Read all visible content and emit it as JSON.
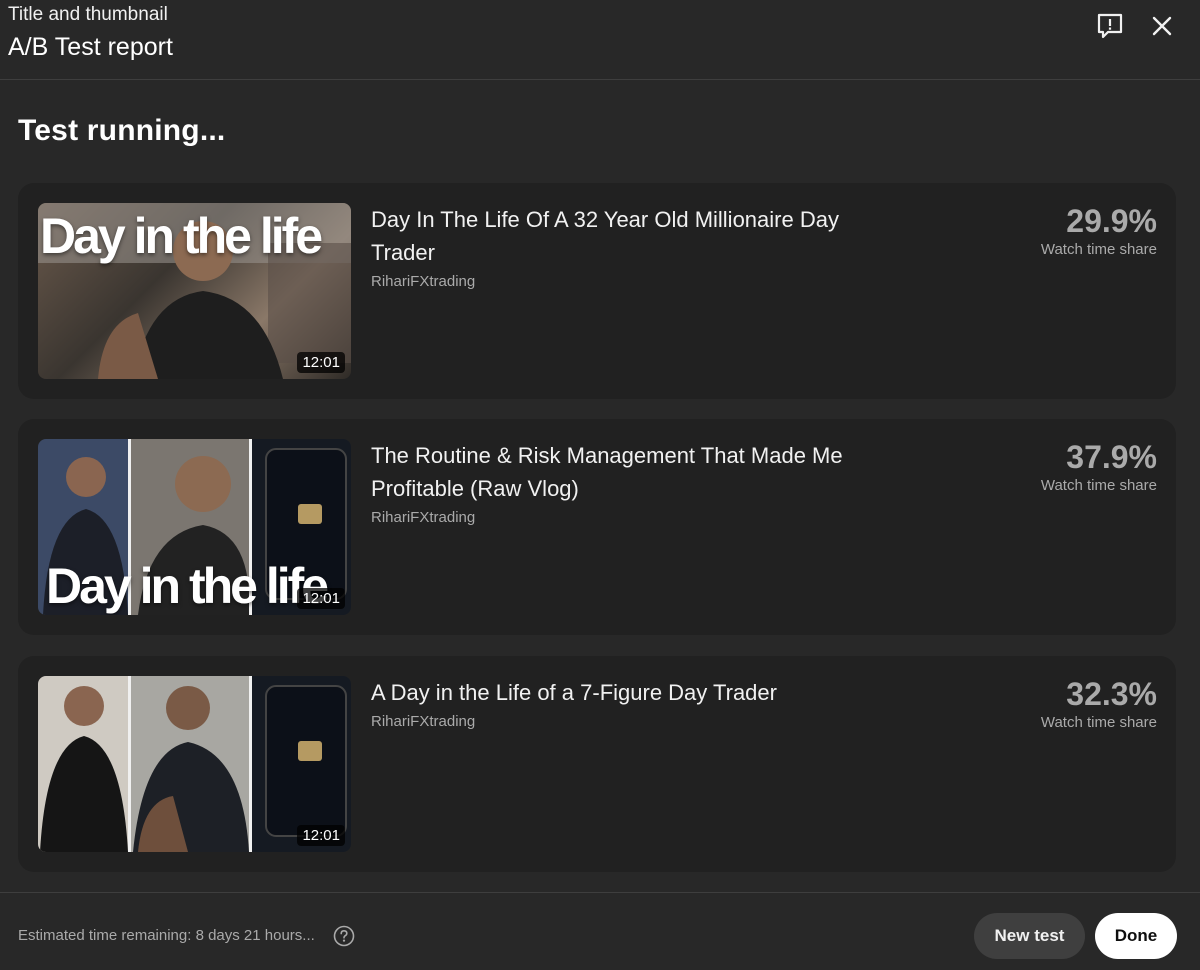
{
  "header": {
    "subtitle": "Title and thumbnail",
    "title": "A/B Test report",
    "feedback_icon": "feedback-icon",
    "close_icon": "close-icon"
  },
  "status": "Test running...",
  "variants": [
    {
      "title": "Day In The Life Of A 32 Year Old Millionaire Day Trader",
      "channel": "RihariFXtrading",
      "duration": "12:01",
      "share": "29.9%",
      "share_label": "Watch time share",
      "thumb_text": "Day in the life"
    },
    {
      "title": "The Routine & Risk Management That Made Me Profitable (Raw Vlog)",
      "channel": "RihariFXtrading",
      "duration": "12:01",
      "share": "37.9%",
      "share_label": "Watch time share",
      "thumb_text": "Day in the life"
    },
    {
      "title": "A Day in the Life of a 7-Figure Day Trader",
      "channel": "RihariFXtrading",
      "duration": "12:01",
      "share": "32.3%",
      "share_label": "Watch time share"
    }
  ],
  "footer": {
    "estimate": "Estimated time remaining: 8 days 21 hours...",
    "help_icon": "help-icon",
    "new_test_label": "New test",
    "done_label": "Done"
  }
}
